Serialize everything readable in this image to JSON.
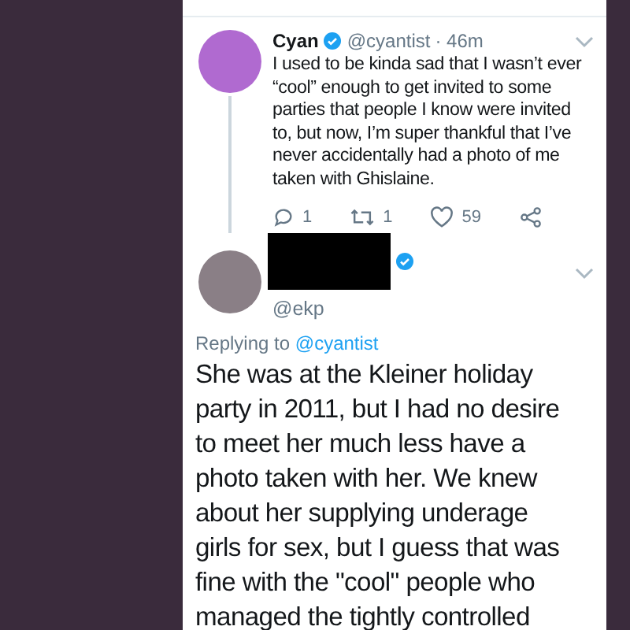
{
  "tweet": {
    "name": "Cyan",
    "verified": true,
    "handle": "@cyantist",
    "time": "· 46m",
    "text": "I used to be kinda sad that I wasn’t ever “cool” enough to get invited to some parties that people I know were invited to, but now, I’m super thankful that I’ve never accidentally had a photo of me taken with Ghislaine.",
    "replies": "1",
    "retweets": "1",
    "likes": "59"
  },
  "reply": {
    "verified": true,
    "handle": "@ekp",
    "replying_label": "Replying to",
    "replying_to": "@cyantist",
    "text": "She was at the Kleiner holiday party in 2011, but I had no desire to meet her much less have a photo taken with her. We knew about her supplying underage girls for sex, but I guess that was fine with the \"cool\" people who managed the tightly controlled"
  }
}
